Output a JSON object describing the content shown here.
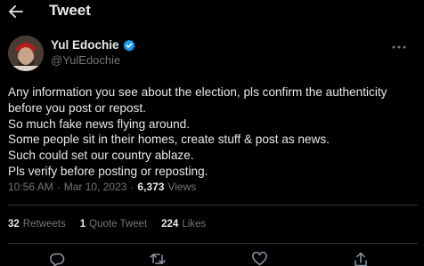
{
  "header": {
    "title": "Tweet"
  },
  "author": {
    "display_name": "Yul Edochie",
    "handle": "@YulEdochie"
  },
  "tweet": {
    "lines": [
      "Any information you see about the election, pls confirm the authenticity",
      "before you post or repost.",
      "So much fake news flying around.",
      "Some people sit in their homes, create stuff & post as news.",
      "Such could set our country ablaze.",
      "Pls verify before posting or reposting."
    ]
  },
  "meta": {
    "time": "10:56 AM",
    "separator": "·",
    "date": "Mar 10, 2023",
    "views_count": "6,373",
    "views_label": "Views"
  },
  "stats": {
    "retweets_count": "32",
    "retweets_label": "Retweets",
    "quotes_count": "1",
    "quotes_label": "Quote Tweet",
    "likes_count": "224",
    "likes_label": "Likes"
  },
  "icons": {
    "back": "back-arrow-icon",
    "verified": "verified-badge-icon",
    "more": "more-icon",
    "reply": "reply-icon",
    "retweet": "retweet-icon",
    "like": "like-icon",
    "share": "share-icon"
  },
  "colors": {
    "background": "#000000",
    "text": "#e7e9ea",
    "muted": "#71767b",
    "accent": "#1d9bf0",
    "divider": "#2f3336"
  }
}
